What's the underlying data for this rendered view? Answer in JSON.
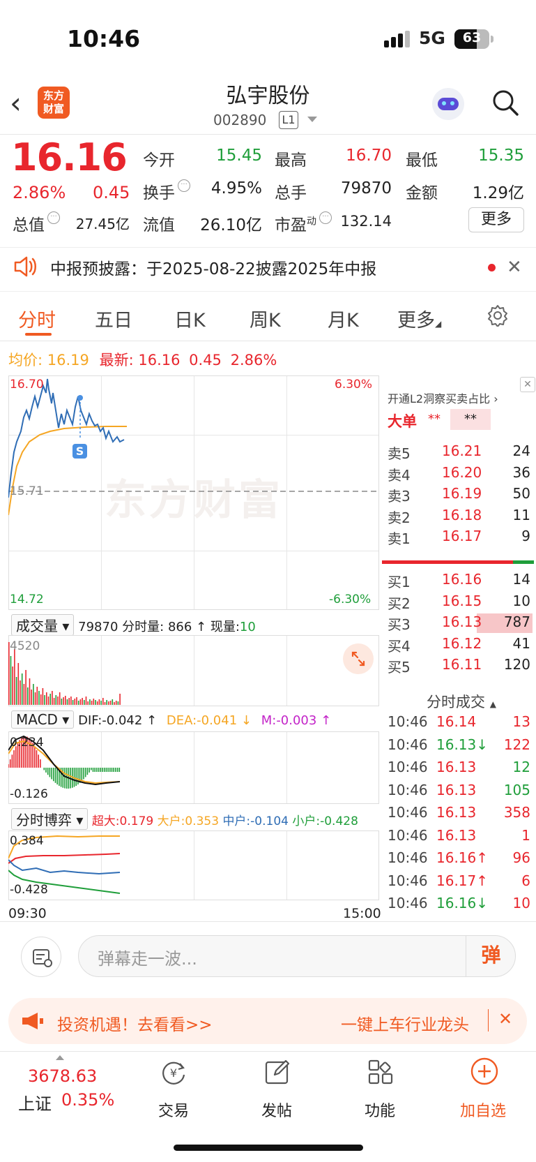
{
  "status_bar": {
    "time": "10:46",
    "network": "5G",
    "battery": "63",
    "battery_level": 0.63
  },
  "header": {
    "title": "弘宇股份",
    "code": "002890",
    "level": "L1"
  },
  "quote": {
    "price": "16.16",
    "change_pct": "2.86%",
    "change": "0.45",
    "fields": {
      "open_label": "今开",
      "open": "15.45",
      "high_label": "最高",
      "high": "16.70",
      "low_label": "最低",
      "low": "15.35",
      "turnover_label": "换手",
      "turnover": "4.95%",
      "volume_label": "总手",
      "volume": "79870",
      "amount_label": "金额",
      "amount": "1.29亿",
      "mktcap_label": "总值",
      "mktcap": "27.45亿",
      "float_label": "流值",
      "float_cap": "26.10亿",
      "pe_label": "市盈",
      "pe_sup": "动",
      "pe": "132.14"
    },
    "more_label": "更多"
  },
  "notice": {
    "text": "中报预披露：于2025-08-22披露2025年中报"
  },
  "tabs": [
    "分时",
    "五日",
    "日K",
    "周K",
    "月K",
    "更多"
  ],
  "summary": {
    "avg_label": "均价:",
    "avg": "16.19",
    "latest_label": "最新:",
    "latest": "16.16",
    "change": "0.45",
    "change_pct": "2.86%"
  },
  "chart": {
    "high_price": "16.70",
    "high_pct": "6.30%",
    "mid_price": "15.71",
    "low_price": "14.72",
    "low_pct": "-6.30%",
    "watermark": "东方财富",
    "marker": "S",
    "time_start": "09:30",
    "time_end": "15:00"
  },
  "volume": {
    "selector": "成交量",
    "total": "79870",
    "tick_label": "分时量:",
    "tick_value": "866",
    "now_label": "现量:",
    "now_value": "10",
    "max": "4520"
  },
  "macd": {
    "selector": "MACD",
    "dif": "DIF:-0.042",
    "dea": "DEA:-0.041",
    "m": "M:-0.003",
    "top": "0.234",
    "bottom": "-0.126"
  },
  "flow": {
    "selector": "分时博弈",
    "super": "超大:0.179",
    "large": "大户:0.353",
    "mid": "中户:-0.104",
    "small": "小户:-0.428",
    "top": "0.384",
    "bottom": "-0.428"
  },
  "order_book": {
    "header": "开通L2洞察买卖占比",
    "big_label": "大单",
    "big_val1": "**",
    "big_val2": "**",
    "asks": [
      {
        "label": "卖5",
        "price": "16.21",
        "vol": "24"
      },
      {
        "label": "卖4",
        "price": "16.20",
        "vol": "36"
      },
      {
        "label": "卖3",
        "price": "16.19",
        "vol": "50"
      },
      {
        "label": "卖2",
        "price": "16.18",
        "vol": "11"
      },
      {
        "label": "卖1",
        "price": "16.17",
        "vol": "9"
      }
    ],
    "bids": [
      {
        "label": "买1",
        "price": "16.16",
        "vol": "14"
      },
      {
        "label": "买2",
        "price": "16.15",
        "vol": "10"
      },
      {
        "label": "买3",
        "price": "16.13",
        "vol": "787"
      },
      {
        "label": "买4",
        "price": "16.12",
        "vol": "41"
      },
      {
        "label": "买5",
        "price": "16.11",
        "vol": "120"
      }
    ],
    "ticks_header": "分时成交",
    "ticks": [
      {
        "time": "10:46",
        "price": "16.14",
        "vol": "13"
      },
      {
        "time": "10:46",
        "price": "16.13↓",
        "vol": "122"
      },
      {
        "time": "10:46",
        "price": "16.13",
        "vol": "12"
      },
      {
        "time": "10:46",
        "price": "16.13",
        "vol": "105"
      },
      {
        "time": "10:46",
        "price": "16.13",
        "vol": "358"
      },
      {
        "time": "10:46",
        "price": "16.13",
        "vol": "1"
      },
      {
        "time": "10:46",
        "price": "16.16↑",
        "vol": "96"
      },
      {
        "time": "10:46",
        "price": "16.17↑",
        "vol": "6"
      },
      {
        "time": "10:46",
        "price": "16.16↓",
        "vol": "10"
      }
    ]
  },
  "danmu": {
    "placeholder": "弹幕走一波...",
    "button": "弹"
  },
  "banner": {
    "left": "投资机遇！去看看>>",
    "right": "一键上车行业龙头"
  },
  "bottom_nav": {
    "index_value": "3678.63",
    "index_name": "上证",
    "index_pct": "0.35%",
    "items": [
      "交易",
      "发帖",
      "功能",
      "加自选"
    ]
  }
}
